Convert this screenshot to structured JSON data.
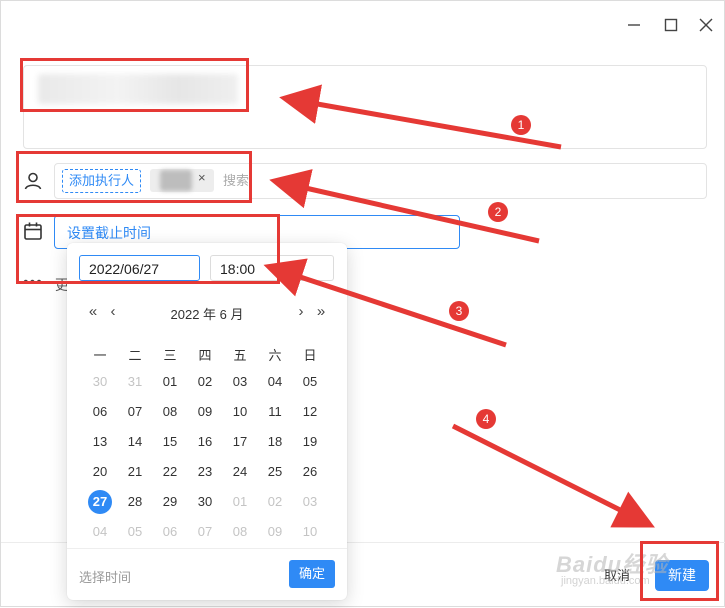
{
  "window_controls": {
    "minimize_icon": "minimize-icon",
    "maximize_icon": "maximize-icon",
    "close_icon": "close-icon"
  },
  "assignee": {
    "add_label": "添加执行人",
    "chip_remove": "×",
    "search_placeholder": "搜索"
  },
  "deadline": {
    "label": "设置截止时间"
  },
  "more": {
    "label": "更"
  },
  "picker": {
    "date_value": "2022/06/27",
    "time_value": "18:00",
    "nav_prev_year": "«",
    "nav_prev_month": "‹",
    "nav_next_month": "›",
    "nav_next_year": "»",
    "month_title": "2022 年 6 月",
    "weekdays": [
      "一",
      "二",
      "三",
      "四",
      "五",
      "六",
      "日"
    ],
    "weeks": [
      [
        {
          "d": "30",
          "m": true
        },
        {
          "d": "31",
          "m": true
        },
        {
          "d": "01"
        },
        {
          "d": "02"
        },
        {
          "d": "03"
        },
        {
          "d": "04"
        },
        {
          "d": "05"
        }
      ],
      [
        {
          "d": "06"
        },
        {
          "d": "07"
        },
        {
          "d": "08"
        },
        {
          "d": "09"
        },
        {
          "d": "10"
        },
        {
          "d": "11"
        },
        {
          "d": "12"
        }
      ],
      [
        {
          "d": "13"
        },
        {
          "d": "14"
        },
        {
          "d": "15"
        },
        {
          "d": "16"
        },
        {
          "d": "17"
        },
        {
          "d": "18"
        },
        {
          "d": "19"
        }
      ],
      [
        {
          "d": "20"
        },
        {
          "d": "21"
        },
        {
          "d": "22"
        },
        {
          "d": "23"
        },
        {
          "d": "24"
        },
        {
          "d": "25"
        },
        {
          "d": "26"
        }
      ],
      [
        {
          "d": "27",
          "s": true
        },
        {
          "d": "28"
        },
        {
          "d": "29"
        },
        {
          "d": "30"
        },
        {
          "d": "01",
          "m": true
        },
        {
          "d": "02",
          "m": true
        },
        {
          "d": "03",
          "m": true
        }
      ],
      [
        {
          "d": "04",
          "m": true
        },
        {
          "d": "05",
          "m": true
        },
        {
          "d": "06",
          "m": true
        },
        {
          "d": "07",
          "m": true
        },
        {
          "d": "08",
          "m": true
        },
        {
          "d": "09",
          "m": true
        },
        {
          "d": "10",
          "m": true
        }
      ]
    ],
    "select_time_label": "选择时间",
    "confirm_label": "确定"
  },
  "footer": {
    "cancel_label": "取消",
    "create_label": "新建"
  },
  "annotations": {
    "badges": [
      "1",
      "2",
      "3",
      "4"
    ],
    "color": "#e53935"
  },
  "watermark": {
    "text": "Baidu经验",
    "sub": "jingyan.baidu.com"
  },
  "colors": {
    "accent": "#2f8af5",
    "annotation": "#e53935"
  }
}
